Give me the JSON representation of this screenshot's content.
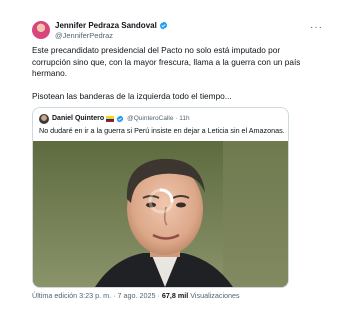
{
  "author": {
    "name": "Jennifer Pedraza Sandoval",
    "handle": "@JenniferPedraz"
  },
  "tweet": {
    "paragraph_1": "Este precandidato presidencial del Pacto no solo está imputado por corrupción sino que, con la mayor frescura, llama a la guerra con un país hermano.",
    "paragraph_2": "Pisotean las banderas de la izquierda todo el tiempo..."
  },
  "quoted": {
    "name": "Daniel Quintero",
    "handle_time": "@QuinteroCalle · 11h",
    "text": "No dudaré en ir a la guerra si Perú insiste en dejar a Leticia sin el Amazonas."
  },
  "footer": {
    "edited_label": "Última edición 3:23 p. m. · 7 ago. 2025 ·",
    "views_count": "67,8 mil",
    "views_label": "Visualizaciones"
  },
  "icons": {
    "verified": "verified-badge-icon",
    "more": "more-icon",
    "flag": "colombia-flag-icon",
    "loading": "loading-spinner-icon"
  },
  "colors": {
    "verified_blue": "#1d9bf0",
    "secondary_text": "#536471",
    "border": "#cfd9de"
  }
}
